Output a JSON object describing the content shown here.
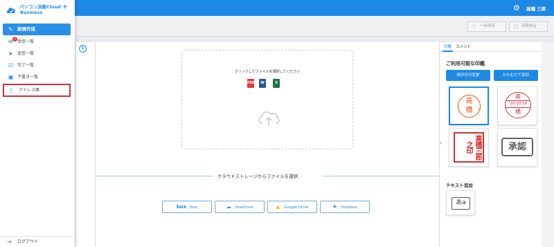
{
  "app": {
    "brand_line1": "パソコン決裁Cloud",
    "brand_line2": "Business"
  },
  "header": {
    "user_name": "高橋 三郎",
    "accent": "#1e88e5"
  },
  "toolbar": {
    "save_temp": "一時保存",
    "send_settings": "回覧設定"
  },
  "sidebar": {
    "new_button": "新規作成",
    "items": [
      {
        "label": "受信一覧",
        "icon": "inbox-icon",
        "badge": "2"
      },
      {
        "label": "送信一覧",
        "icon": "send-icon"
      },
      {
        "label": "完了一覧",
        "icon": "check-square-icon"
      },
      {
        "label": "下書き一覧",
        "icon": "save-icon"
      },
      {
        "label": "アドレス帳",
        "icon": "address-book-icon"
      }
    ],
    "logout": "ログアウト"
  },
  "upload": {
    "instruction": "クリックしてファイルを選択してください",
    "file_types": [
      "PDF",
      "W",
      "X"
    ],
    "cloud_divider": "クラウドストレージからファイルを選択",
    "services": [
      "Box",
      "OneDrive",
      "Google Drive",
      "Dropbox"
    ]
  },
  "right_panel": {
    "tabs": [
      "印鑑",
      "コメント"
    ],
    "heading": "ご利用可能な印鑑",
    "date_change_button": "捺印日付変更",
    "tilt_button": "かたむけて捺印",
    "stamps": {
      "round_name": "高橋",
      "date_stamp_top": "高",
      "date_stamp_date": "'20/10/16",
      "date_stamp_bottom": "橋",
      "square_seal_text": "高橋三郎之印",
      "approval_text": "承認"
    },
    "text_add_heading": "テキスト追加",
    "text_tool_sample": "あa"
  }
}
